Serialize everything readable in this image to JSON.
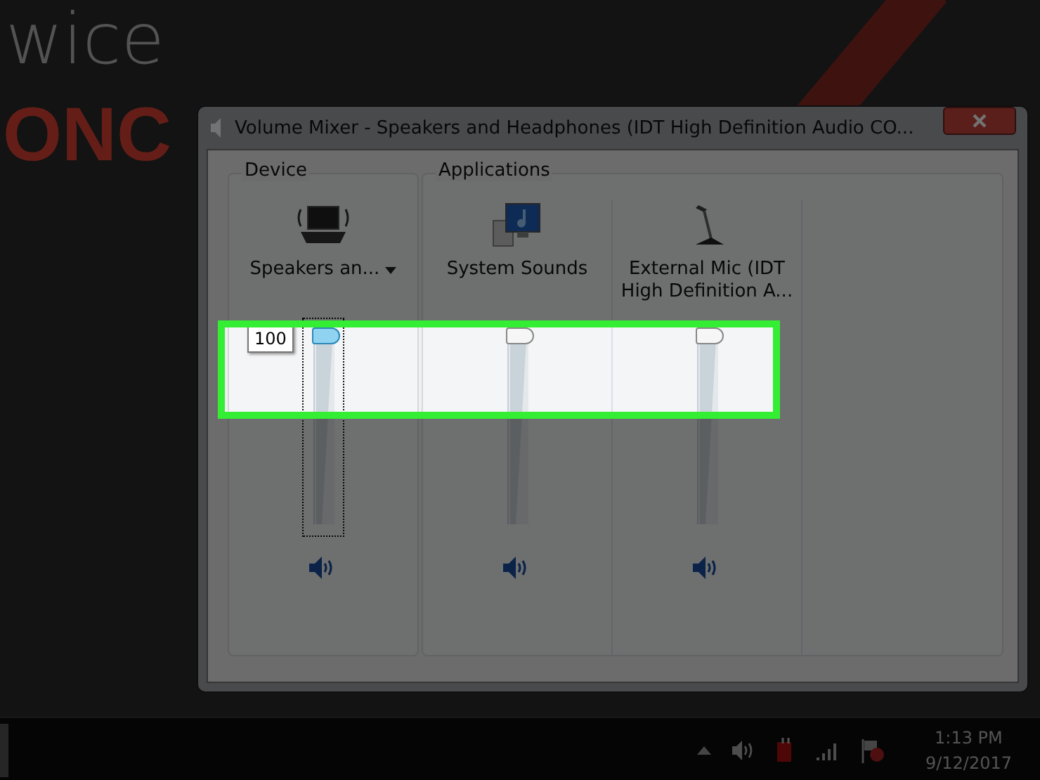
{
  "wallpaper": {
    "texts": [
      "wice",
      "ONC"
    ]
  },
  "window": {
    "title": "Volume Mixer - Speakers and Headphones (IDT High Definition Audio CO..."
  },
  "device_group": {
    "label": "Device",
    "channels": [
      {
        "kind": "device",
        "name": "Speakers an...",
        "level": 1,
        "muted": false,
        "focused": true,
        "tooltip": "100"
      }
    ]
  },
  "applications_group": {
    "label": "Applications",
    "channels": [
      {
        "kind": "system",
        "name": "System Sounds",
        "level": 1,
        "muted": false,
        "focused": false
      },
      {
        "kind": "mic",
        "name": "External Mic (IDT High Definition A...",
        "level": 1,
        "muted": false,
        "focused": false
      }
    ]
  },
  "taskbar": {
    "clock": {
      "time": "1:13 PM",
      "date": "9/12/2017"
    }
  }
}
